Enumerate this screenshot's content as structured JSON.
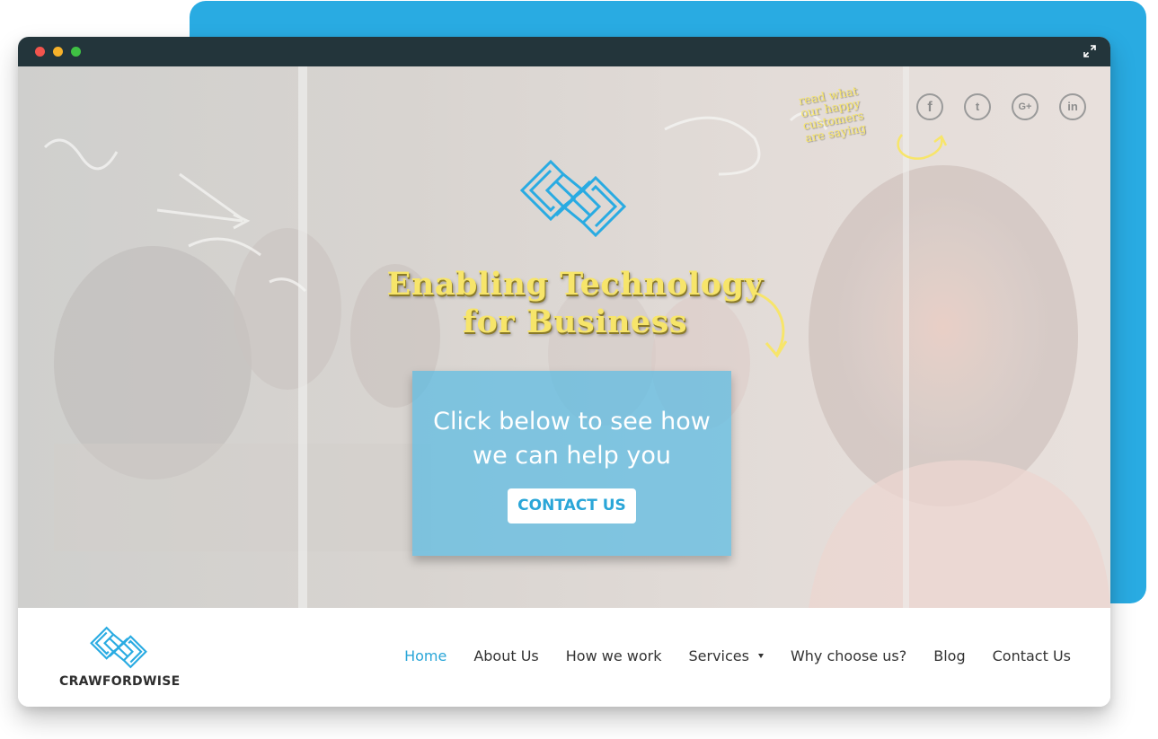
{
  "colors": {
    "accent_blue": "#29abe2",
    "titlebar": "#23353b",
    "tagline_yellow": "#f7e56a",
    "nav_active": "#2aa6d8",
    "nav_text": "#333333"
  },
  "browser": {
    "controls": [
      "close-dot",
      "minimize-dot",
      "maximize-dot"
    ],
    "expand_icon": "expand-icon"
  },
  "hero": {
    "logo_icon": "crawfordwise-maze-logo",
    "tagline": {
      "line1": "Enabling Technology",
      "line2": "for Business"
    },
    "reviews_note": {
      "line1": "read what",
      "line2": "our happy",
      "line3": "customers",
      "line4": "are saying"
    },
    "social": [
      {
        "name": "facebook",
        "glyph": "f"
      },
      {
        "name": "twitter",
        "glyph": "t"
      },
      {
        "name": "google-plus",
        "glyph": "G+"
      },
      {
        "name": "linkedin",
        "glyph": "in"
      }
    ],
    "cta": {
      "line1": "Click below to see how",
      "line2": "we can help you",
      "button_label": "CONTACT US"
    }
  },
  "header": {
    "brand_name": "CRAWFORDWISE",
    "nav": [
      {
        "label": "Home",
        "active": true
      },
      {
        "label": "About Us"
      },
      {
        "label": "How we work"
      },
      {
        "label": "Services",
        "has_dropdown": true
      },
      {
        "label": "Why choose us?"
      },
      {
        "label": "Blog"
      },
      {
        "label": "Contact Us"
      }
    ]
  }
}
